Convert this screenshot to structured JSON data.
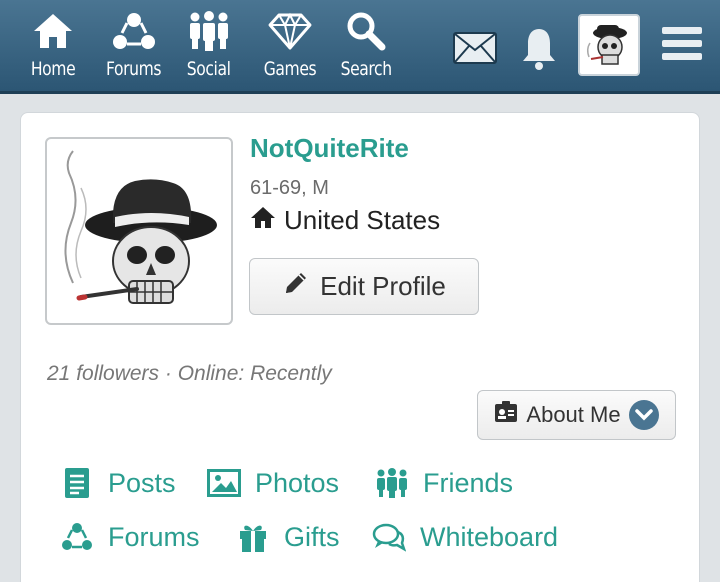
{
  "nav": {
    "items": [
      {
        "label": "Home",
        "icon": "home-icon"
      },
      {
        "label": "Forums",
        "icon": "forums-icon"
      },
      {
        "label": "Social",
        "icon": "social-icon"
      },
      {
        "label": "Games",
        "icon": "diamond-icon"
      },
      {
        "label": "Search",
        "icon": "search-icon"
      }
    ],
    "right_icons": [
      "mail-icon",
      "bell-icon",
      "avatar",
      "menu-icon"
    ]
  },
  "profile": {
    "username": "NotQuiteRite",
    "age_sex": "61-69, M",
    "location": "United States",
    "edit_label": "Edit Profile",
    "meta": "21 followers · Online: Recently",
    "about_label": "About Me"
  },
  "links": [
    {
      "label": "Posts",
      "icon": "posts-icon"
    },
    {
      "label": "Photos",
      "icon": "photos-icon"
    },
    {
      "label": "Friends",
      "icon": "friends-icon"
    },
    {
      "label": "Forums",
      "icon": "forums-icon"
    },
    {
      "label": "Gifts",
      "icon": "gift-icon"
    },
    {
      "label": "Whiteboard",
      "icon": "whiteboard-icon"
    }
  ],
  "colors": {
    "accent": "#2a9d8f",
    "header": "#3a6583"
  }
}
